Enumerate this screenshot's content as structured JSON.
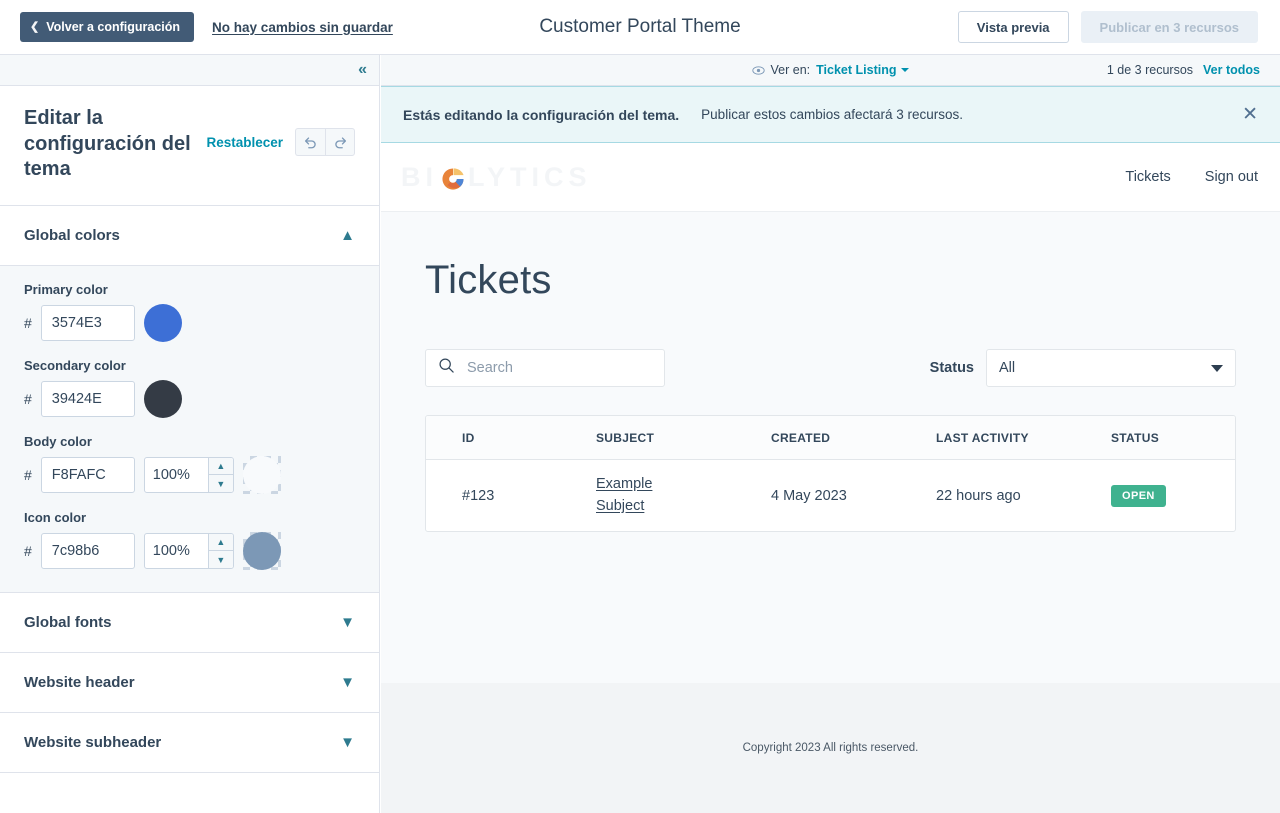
{
  "topbar": {
    "back_label": "Volver a configuración",
    "back_icon": "chevron-left-icon",
    "unsaved_label": "No hay cambios sin guardar",
    "doc_title": "Customer Portal Theme",
    "preview_label": "Vista previa",
    "publish_label": "Publicar en 3 recursos"
  },
  "sidebar": {
    "collapse_icon": "double-chevron-left-icon",
    "title": "Editar la configuración del tema",
    "reset_label": "Restablecer",
    "undo_icon": "undo-arrow-icon",
    "redo_icon": "redo-arrow-icon",
    "sections": [
      {
        "label": "Global colors",
        "expanded": true,
        "chevron": "chevron-up-icon"
      },
      {
        "label": "Global fonts",
        "expanded": false,
        "chevron": "chevron-down-icon"
      },
      {
        "label": "Website header",
        "expanded": false,
        "chevron": "chevron-down-icon"
      },
      {
        "label": "Website subheader",
        "expanded": false,
        "chevron": "chevron-down-icon"
      }
    ],
    "colors": [
      {
        "label": "Primary color",
        "hash": "#",
        "hex": "3574E3",
        "swatch": "#3d6fd6",
        "has_opacity": false,
        "opacity": ""
      },
      {
        "label": "Secondary color",
        "hash": "#",
        "hex": "39424E",
        "swatch": "#343b45",
        "has_opacity": false,
        "opacity": ""
      },
      {
        "label": "Body color",
        "hash": "#",
        "hex": "F8FAFC",
        "swatch": "#f8fafc",
        "has_opacity": true,
        "opacity": "100%"
      },
      {
        "label": "Icon color",
        "hash": "#",
        "hex": "7c98b6",
        "swatch": "#7c98b6",
        "has_opacity": true,
        "opacity": "100%"
      }
    ]
  },
  "viewbar": {
    "eye_icon": "eye-icon",
    "view_in_label": "Ver en:",
    "selected_page": "Ticket Listing",
    "count_label": "1 de 3 recursos",
    "see_all_label": "Ver todos"
  },
  "banner": {
    "strong": "Estás editando la configuración del tema.",
    "text": "Publicar estos cambios afectará 3 recursos.",
    "close_icon": "close-icon"
  },
  "site": {
    "logo_text_before": "BI",
    "logo_mark": "biglytics-logo-mark",
    "logo_text_after": "LYTICS",
    "nav": [
      {
        "label": "Tickets"
      },
      {
        "label": "Sign out"
      }
    ],
    "page_title": "Tickets",
    "search": {
      "icon": "search-icon",
      "placeholder": "Search",
      "value": ""
    },
    "status_filter": {
      "label": "Status",
      "value": "All",
      "caret": "caret-down-icon"
    },
    "table": {
      "columns": [
        "ID",
        "SUBJECT",
        "CREATED",
        "LAST ACTIVITY",
        "STATUS"
      ],
      "rows": [
        {
          "id": "#123",
          "subject": "Example Subject",
          "created": "4 May 2023",
          "last_activity": "22 hours ago",
          "status": "OPEN",
          "status_color": "#3fb28f"
        }
      ]
    },
    "footer_copyright": "Copyright 2023 All rights reserved."
  }
}
